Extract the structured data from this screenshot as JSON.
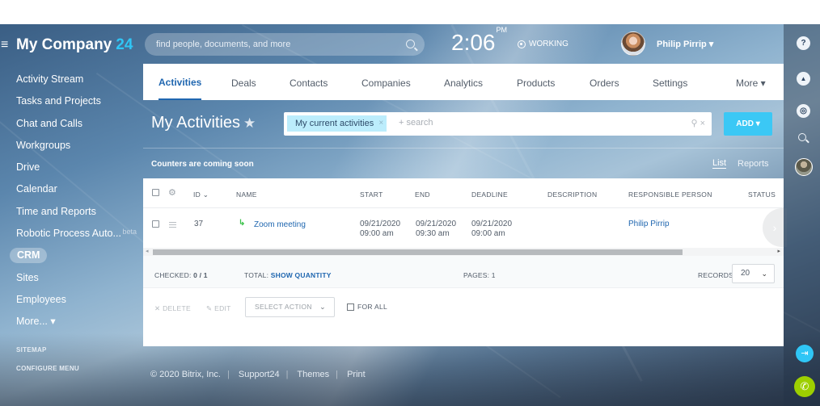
{
  "app": {
    "company_name": "My Company",
    "company_num": "24",
    "search_placeholder": "find people, documents, and more",
    "time": "2:06",
    "ampm": "PM",
    "status": "WORKING",
    "user_name": "Philip Pirrip",
    "user_caret": "▾"
  },
  "sidebar": {
    "items": [
      {
        "label": "Activity Stream"
      },
      {
        "label": "Tasks and Projects"
      },
      {
        "label": "Chat and Calls"
      },
      {
        "label": "Workgroups"
      },
      {
        "label": "Drive"
      },
      {
        "label": "Calendar"
      },
      {
        "label": "Time and Reports"
      },
      {
        "label": "Robotic Process Auto..."
      },
      {
        "label": "CRM"
      },
      {
        "label": "Sites"
      },
      {
        "label": "Employees"
      },
      {
        "label": "More... ▾"
      }
    ],
    "beta": "beta",
    "sitemap": "SITEMAP",
    "configure": "CONFIGURE MENU"
  },
  "tabs": [
    {
      "label": "Activities"
    },
    {
      "label": "Deals"
    },
    {
      "label": "Contacts"
    },
    {
      "label": "Companies"
    },
    {
      "label": "Analytics"
    },
    {
      "label": "Products"
    },
    {
      "label": "Orders"
    },
    {
      "label": "Settings"
    },
    {
      "label": "More ▾"
    }
  ],
  "page": {
    "title": "My Activities",
    "filter_tag": "My current activities",
    "filter_tag_remove": "×",
    "filter_placeholder": "+ search",
    "filter_icons": "⚲ ×",
    "add_button": "ADD ▾",
    "counters_text": "Counters are coming soon",
    "view_list": "List",
    "view_reports": "Reports"
  },
  "grid": {
    "columns": {
      "id": "ID ⌄",
      "name": "NAME",
      "start": "START",
      "end": "END",
      "deadline": "DEADLINE",
      "description": "DESCRIPTION",
      "responsible": "RESPONSIBLE PERSON",
      "status": "STATUS"
    },
    "row": {
      "id": "37",
      "name": "Zoom meeting",
      "start_date": "09/21/2020",
      "start_time": "09:00 am",
      "end_date": "09/21/2020",
      "end_time": "09:30 am",
      "deadline_date": "09/21/2020",
      "deadline_time": "09:00 am",
      "responsible": "Philip Pirrip"
    },
    "footer": {
      "checked_label": "CHECKED:",
      "checked_value": "0 / 1",
      "total_label": "TOTAL:",
      "total_link": "SHOW QUANTITY",
      "pages_label": "PAGES:",
      "pages_value": "1",
      "records_label": "RECORDS:",
      "records_value": "20"
    },
    "actions": {
      "delete": "DELETE",
      "edit": "EDIT",
      "select_action": "SELECT ACTION",
      "for_all": "FOR ALL"
    }
  },
  "footer": {
    "copyright": "© 2020 Bitrix, Inc.",
    "support": "Support24",
    "themes": "Themes",
    "print": "Print"
  },
  "colors": {
    "accent": "#2067b0",
    "add_button": "#3bc8f5",
    "filter_tag": "#bcedfc",
    "logo_num": "#2fc6f6",
    "call_icon": "#3bc14a",
    "phone_button": "#9dcf00"
  },
  "icons": {
    "burger": "≡",
    "star": "★",
    "phone": "↳",
    "gear": "⚙",
    "chev": "⌄",
    "next": "›",
    "question": "?",
    "bell": "▲",
    "chat": "◎",
    "exit": "⇥",
    "call": "✆",
    "delete_x": "✕",
    "edit_pen": "✎",
    "scroll_left": "◂",
    "scroll_right": "▸"
  }
}
